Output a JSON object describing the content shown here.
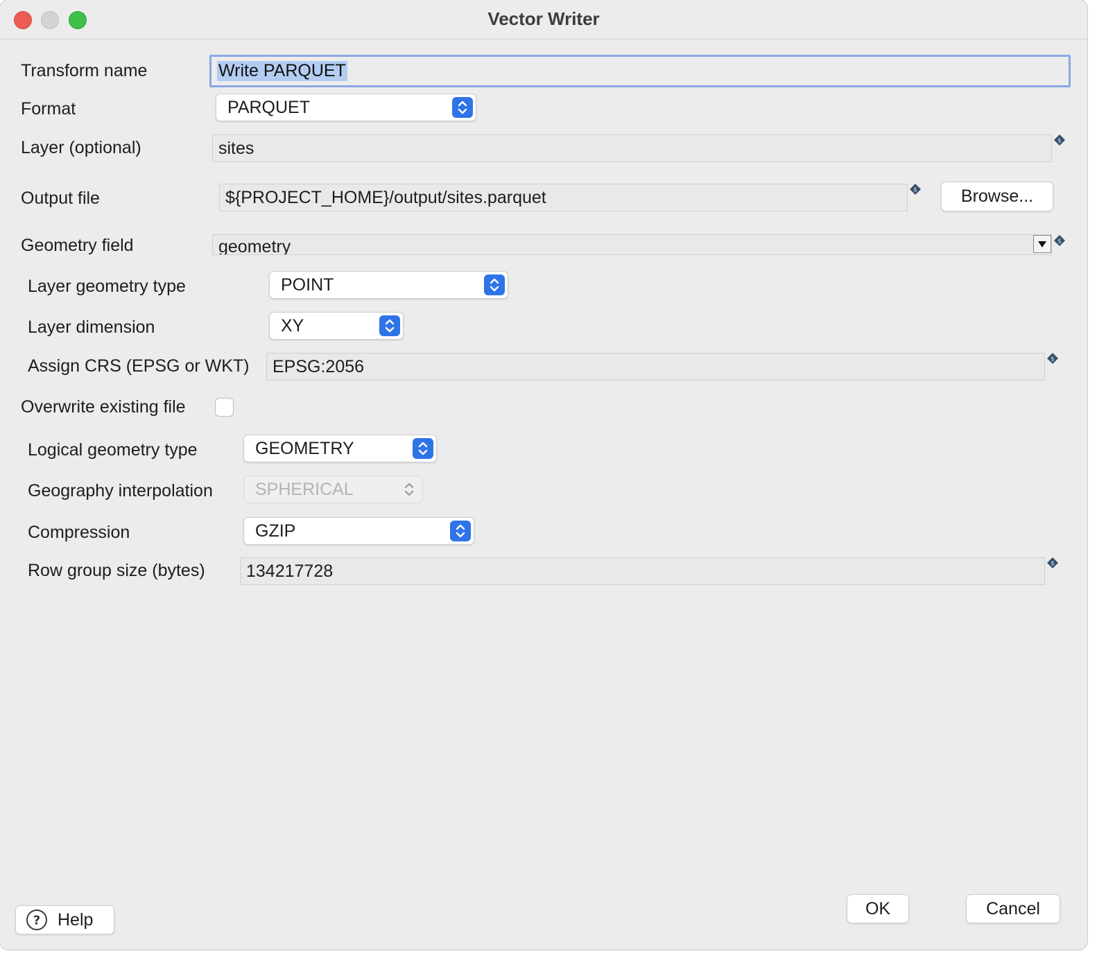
{
  "window": {
    "title": "Vector Writer"
  },
  "form": {
    "transform_name": {
      "label": "Transform name",
      "value": "Write PARQUET"
    },
    "format": {
      "label": "Format",
      "value": "PARQUET"
    },
    "layer": {
      "label": "Layer (optional)",
      "value": "sites"
    },
    "output_file": {
      "label": "Output file",
      "value": "${PROJECT_HOME}/output/sites.parquet",
      "browse_label": "Browse..."
    },
    "geometry_field": {
      "label": "Geometry field",
      "value": "geometry"
    },
    "layer_geometry_type": {
      "label": "Layer geometry type",
      "value": "POINT"
    },
    "layer_dimension": {
      "label": "Layer dimension",
      "value": "XY"
    },
    "assign_crs": {
      "label": "Assign CRS (EPSG or WKT)",
      "value": "EPSG:2056"
    },
    "overwrite": {
      "label": "Overwrite existing file",
      "checked": false
    },
    "logical_geometry_type": {
      "label": "Logical geometry type",
      "value": "GEOMETRY"
    },
    "geography_interpolation": {
      "label": "Geography interpolation",
      "value": "SPHERICAL",
      "enabled": false
    },
    "compression": {
      "label": "Compression",
      "value": "GZIP"
    },
    "row_group_size": {
      "label": "Row group size (bytes)",
      "value": "134217728"
    }
  },
  "footer": {
    "help_label": "Help",
    "ok_label": "OK",
    "cancel_label": "Cancel"
  },
  "colors": {
    "accent": "#2f73e8",
    "focus_ring": "#8aa7e6",
    "selection": "#b3cdf2"
  }
}
